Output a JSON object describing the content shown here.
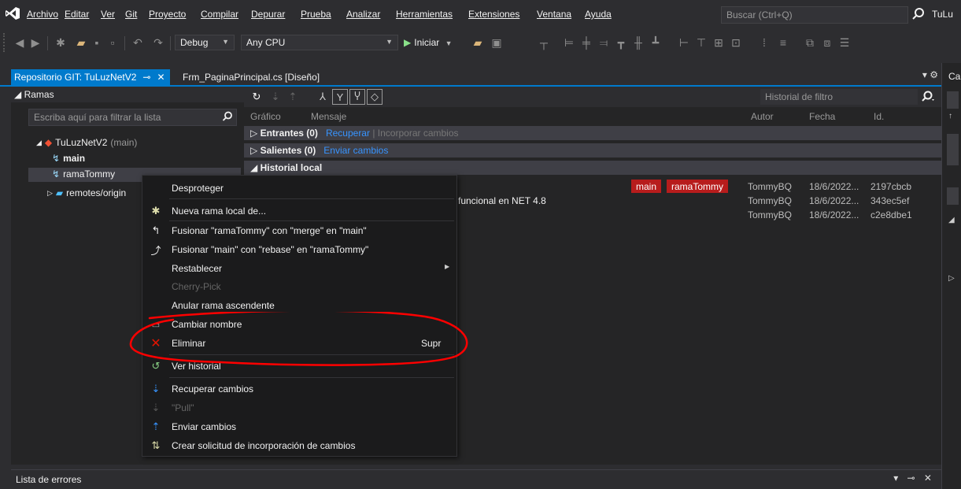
{
  "menubar": {
    "items": [
      "Archivo",
      "Editar",
      "Ver",
      "Git",
      "Proyecto",
      "Compilar",
      "Depurar",
      "Prueba",
      "Analizar",
      "Herramientas",
      "Extensiones",
      "Ventana",
      "Ayuda"
    ],
    "search_placeholder": "Buscar (Ctrl+Q)",
    "account": "TuLu"
  },
  "toolbar": {
    "config": "Debug",
    "platform": "Any CPU",
    "run_label": "Iniciar"
  },
  "tabs": {
    "active": "Repositorio GIT: TuLuzNetV2",
    "other": "Frm_PaginaPrincipal.cs [Diseño]"
  },
  "branches": {
    "header": "Ramas",
    "filter_placeholder": "Escriba aquí para filtrar la lista",
    "repo": "TuLuzNetV2",
    "repo_branch": "(main)",
    "main": "main",
    "rama": "ramaTommy",
    "remotes": "remotes/origin"
  },
  "history": {
    "search_placeholder": "Historial de filtro",
    "columns": {
      "grafico": "Gráfico",
      "mensaje": "Mensaje",
      "autor": "Autor",
      "fecha": "Fecha",
      "id": "Id."
    },
    "incoming": "Entrantes (0)",
    "incoming_fetch": "Recuperar",
    "incoming_merge": "Incorporar cambios",
    "outgoing": "Salientes (0)",
    "outgoing_push": "Enviar cambios",
    "local": "Historial local",
    "tags": [
      "main",
      "ramaTommy"
    ],
    "commit_msg_fragment": "funcional en NET 4.8",
    "commits": [
      {
        "author": "TommyBQ",
        "date": "18/6/2022...",
        "id": "2197cbcb"
      },
      {
        "author": "TommyBQ",
        "date": "18/6/2022...",
        "id": "343ec5ef"
      },
      {
        "author": "TommyBQ",
        "date": "18/6/2022...",
        "id": "c2e8dbe1"
      }
    ]
  },
  "context_menu": {
    "desproteger": "Desproteger",
    "nueva_rama": "Nueva rama local de...",
    "fusionar_merge": "Fusionar \"ramaTommy\" con \"merge\" en \"main\"",
    "fusionar_rebase": "Fusionar \"main\" con \"rebase\" en \"ramaTommy\"",
    "restablecer": "Restablecer",
    "cherry_pick": "Cherry-Pick",
    "anular": "Anular rama ascendente",
    "cambiar_nombre": "Cambiar nombre",
    "eliminar": "Eliminar",
    "eliminar_shortcut": "Supr",
    "ver_historial": "Ver historial",
    "recuperar": "Recuperar cambios",
    "pull": "\"Pull\"",
    "enviar": "Enviar cambios",
    "crear_solicitud": "Crear solicitud de incorporación de cambios"
  },
  "errors": {
    "title": "Lista de errores"
  },
  "rightstrip": {
    "label": "Ca"
  },
  "colors": {
    "accent": "#007acc",
    "tag": "#b71c1c",
    "annotation": "#ff0000",
    "link": "#3794ff"
  }
}
